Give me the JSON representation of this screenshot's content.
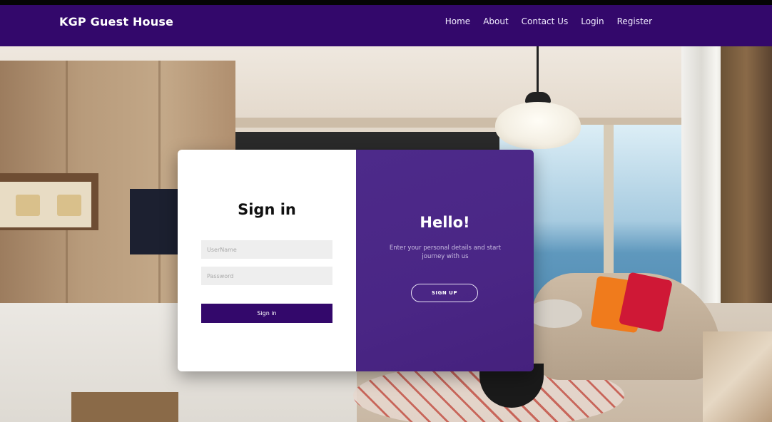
{
  "navbar": {
    "brand": "KGP Guest House",
    "links": [
      "Home",
      "About",
      "Contact Us",
      "Login",
      "Register"
    ]
  },
  "signin": {
    "title": "Sign in",
    "username_placeholder": "UserName",
    "password_placeholder": "Password",
    "button_label": "Sign in"
  },
  "signup_panel": {
    "title": "Hello!",
    "subtitle": "Enter your personal details and start journey with us",
    "button_label": "SIGN UP"
  },
  "colors": {
    "navbar": "#33086b",
    "panel": "#4a2685",
    "button": "#33086b"
  }
}
